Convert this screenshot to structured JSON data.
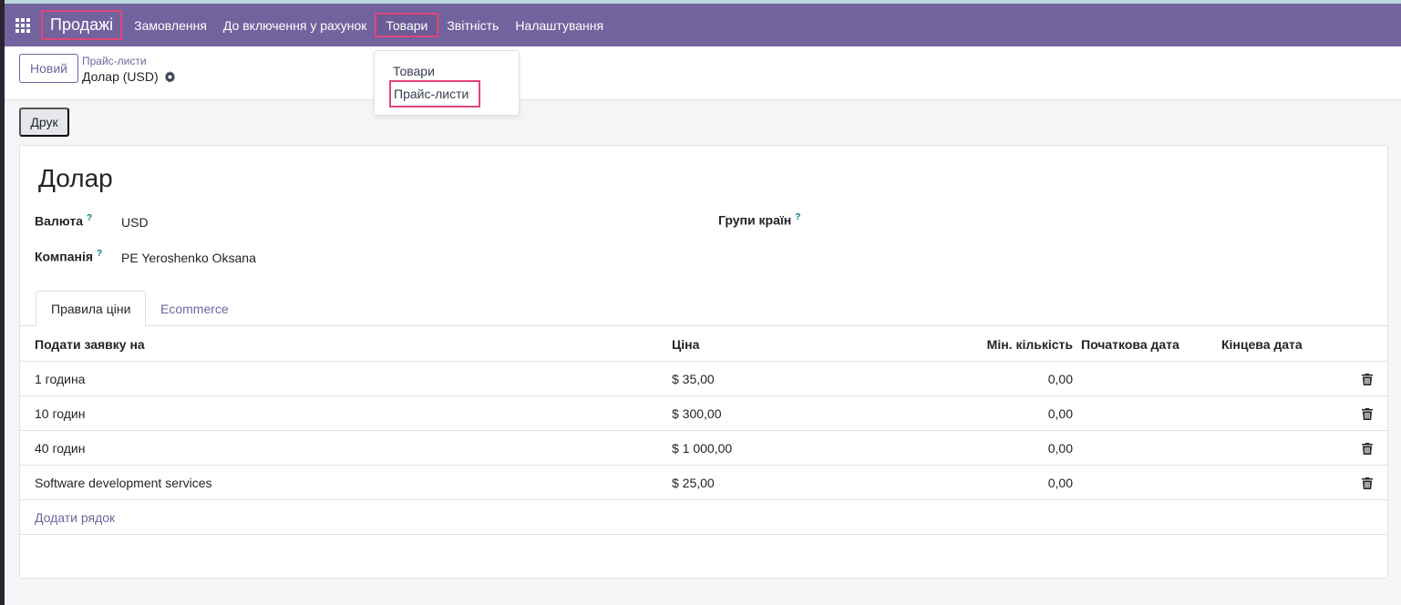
{
  "navbar": {
    "brand": "Продажі",
    "menu": [
      "Замовлення",
      "До включення у рахунок",
      "Товари",
      "Звітність",
      "Налаштування"
    ]
  },
  "control_panel": {
    "new_label": "Новий",
    "breadcrumb_parent": "Прайс-листи",
    "breadcrumb_current": "Долар (USD)"
  },
  "dropdown": {
    "items": [
      "Товари",
      "Прайс-листи"
    ]
  },
  "print_label": "Друк",
  "form": {
    "title": "Долар",
    "currency_label": "Валюта",
    "currency_value": "USD",
    "company_label": "Компанія",
    "company_value": "PE Yeroshenko Oksana",
    "country_groups_label": "Групи країн",
    "help_mark": "?"
  },
  "tabs": [
    "Правила ціни",
    "Ecommerce"
  ],
  "grid": {
    "headers": {
      "product": "Подати заявку на",
      "price": "Ціна",
      "min_qty": "Мін. кількість",
      "start": "Початкова дата",
      "end": "Кінцева дата"
    },
    "rows": [
      {
        "product": "1 година",
        "price": "$ 35,00",
        "min_qty": "0,00"
      },
      {
        "product": "10 годин",
        "price": "$ 300,00",
        "min_qty": "0,00"
      },
      {
        "product": "40 годин",
        "price": "$ 1 000,00",
        "min_qty": "0,00"
      },
      {
        "product": "Software development services",
        "price": "$ 25,00",
        "min_qty": "0,00"
      }
    ],
    "add_line": "Додати рядок"
  },
  "colors": {
    "navbar": "#71639e",
    "highlight": "#e0457b",
    "link": "#71639e"
  }
}
